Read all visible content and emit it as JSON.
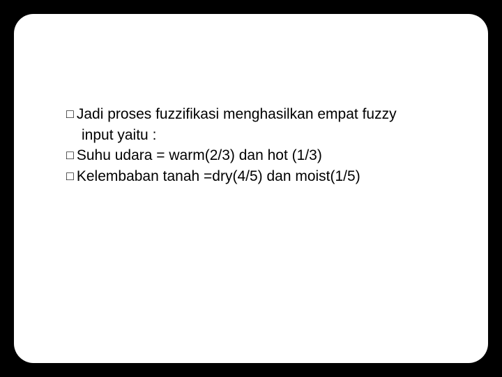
{
  "bullets": [
    {
      "line1": "Jadi proses fuzzifikasi menghasilkan empat  fuzzy",
      "line2": "input yaitu :"
    },
    {
      "line1": "Suhu udara = warm(2/3) dan hot (1/3)"
    },
    {
      "line1": "Kelembaban tanah =dry(4/5) dan moist(1/5)"
    }
  ],
  "marker": "□"
}
